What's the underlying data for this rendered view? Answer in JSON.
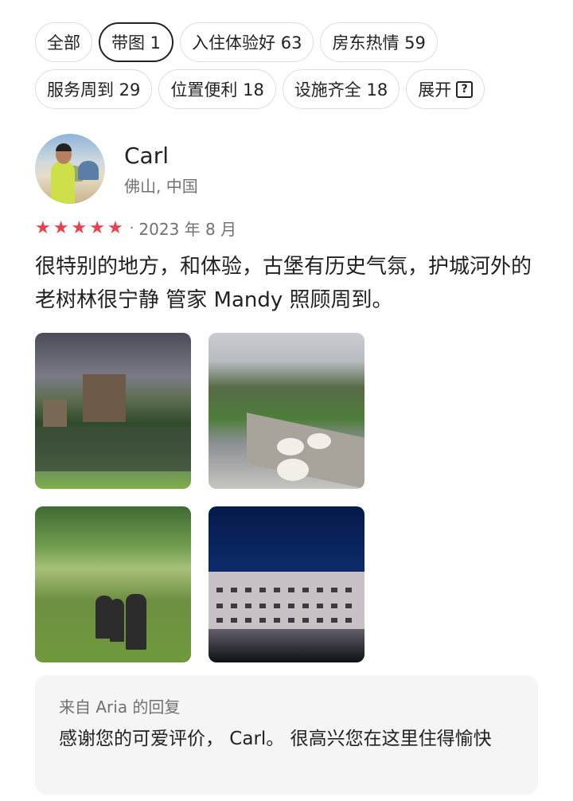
{
  "filters": {
    "row1": [
      {
        "label": "全部",
        "selected": false
      },
      {
        "label": "带图 1",
        "selected": true
      },
      {
        "label": "入住体验好 63",
        "selected": false
      },
      {
        "label": "房东热情 59",
        "selected": false
      }
    ],
    "row2": [
      {
        "label": "服务周到 29",
        "selected": false
      },
      {
        "label": "位置便利 18",
        "selected": false
      },
      {
        "label": "设施齐全 18",
        "selected": false
      },
      {
        "label": "展开",
        "selected": false,
        "icon": "help-box-icon",
        "icon_glyph": "?"
      }
    ]
  },
  "review": {
    "reviewer_name": "Carl",
    "reviewer_location": "佛山, 中国",
    "rating": 5,
    "star_glyph": "★",
    "separator": "·",
    "date": "2023 年 8 月",
    "text": "很特别的地方，和体验，古堡有历史气氛，护城河外的老树林很宁静 管家 Mandy 照顾周到。",
    "photos": [
      "castle-moat-photo",
      "picnic-breakfast-photo",
      "forest-walk-photo",
      "castle-night-photo"
    ]
  },
  "reply": {
    "title": "来自 Aria 的回复",
    "text": "感谢您的可爱评价， Carl。 很高兴您在这里住得愉快"
  },
  "colors": {
    "star": "#e8424f",
    "selected_border": "#222222",
    "chip_border": "#dddddd",
    "muted_text": "#717171",
    "reply_bg": "#f5f5f5"
  }
}
